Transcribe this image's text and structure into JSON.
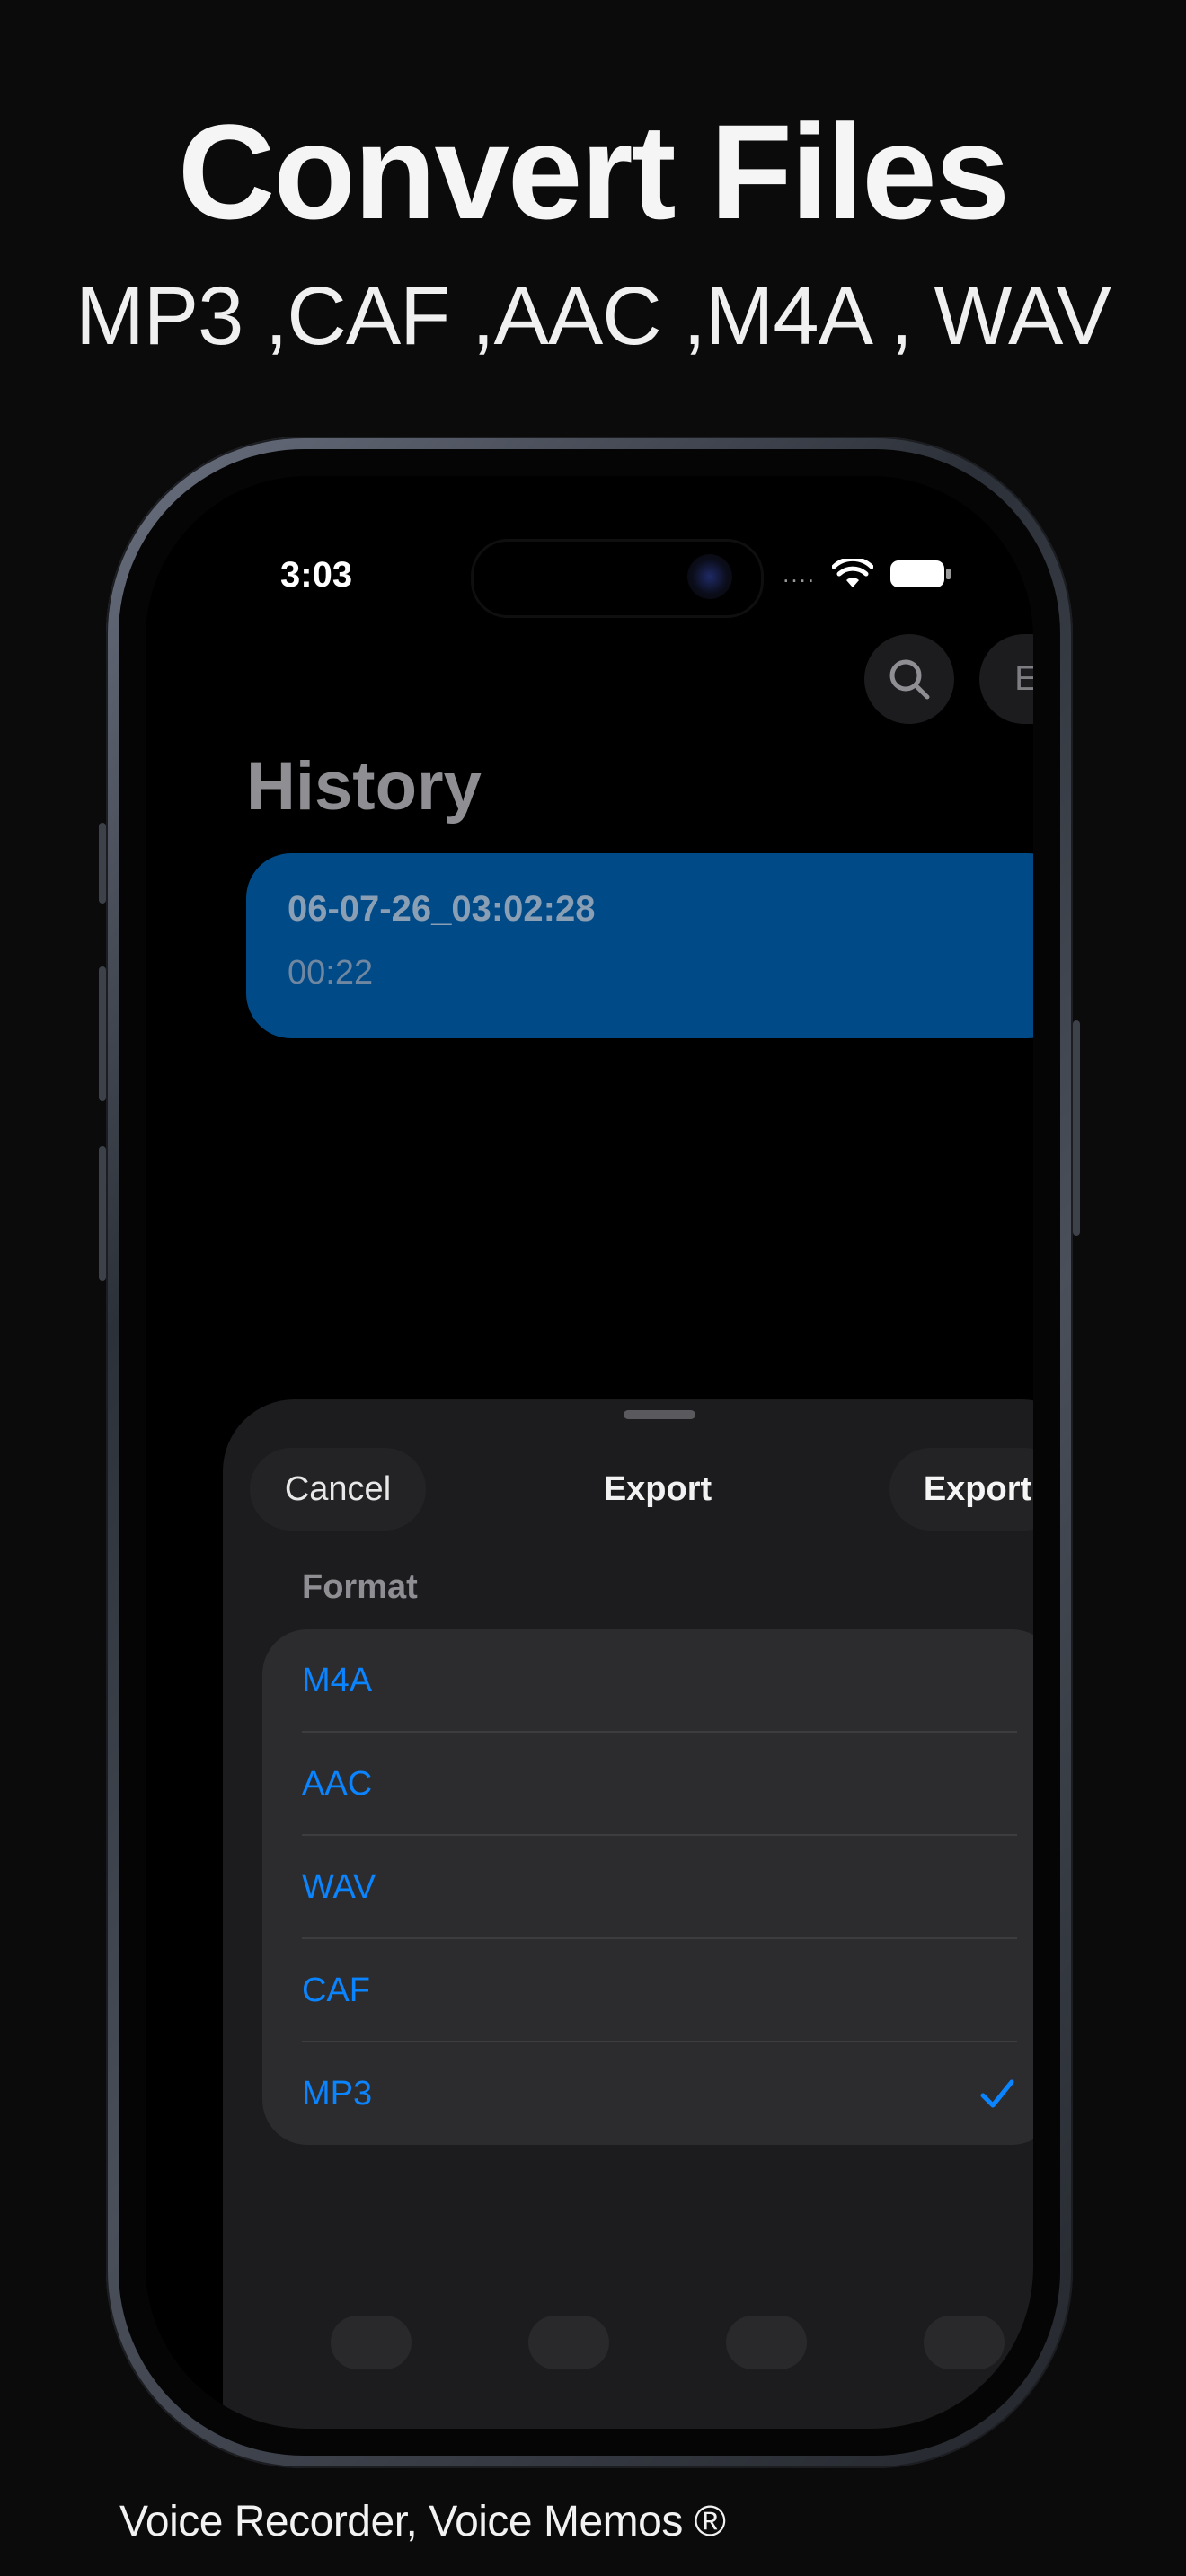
{
  "promo": {
    "headline": "Convert Files",
    "subline": "MP3 ,CAF ,AAC ,M4A , WAV",
    "footer": "Voice Recorder, Voice Memos ®"
  },
  "status_bar": {
    "time": "3:03",
    "dots": "....",
    "icons": [
      "wifi-icon",
      "battery-icon"
    ]
  },
  "toolbar": {
    "search_icon": "search-icon",
    "edit_label": "Edit"
  },
  "history": {
    "title": "History",
    "recordings": [
      {
        "name": "06-07-26_03:02:28",
        "duration": "00:22"
      }
    ]
  },
  "export_sheet": {
    "cancel_label": "Cancel",
    "title": "Export",
    "export_label": "Export",
    "format_label": "Format",
    "formats": [
      {
        "label": "M4A",
        "selected": false
      },
      {
        "label": "AAC",
        "selected": false
      },
      {
        "label": "WAV",
        "selected": false
      },
      {
        "label": "CAF",
        "selected": false
      },
      {
        "label": "MP3",
        "selected": true
      }
    ]
  },
  "colors": {
    "accent": "#0a84ff",
    "card": "#014a88",
    "sheet": "#1c1c1e",
    "list": "#2c2c2e"
  }
}
